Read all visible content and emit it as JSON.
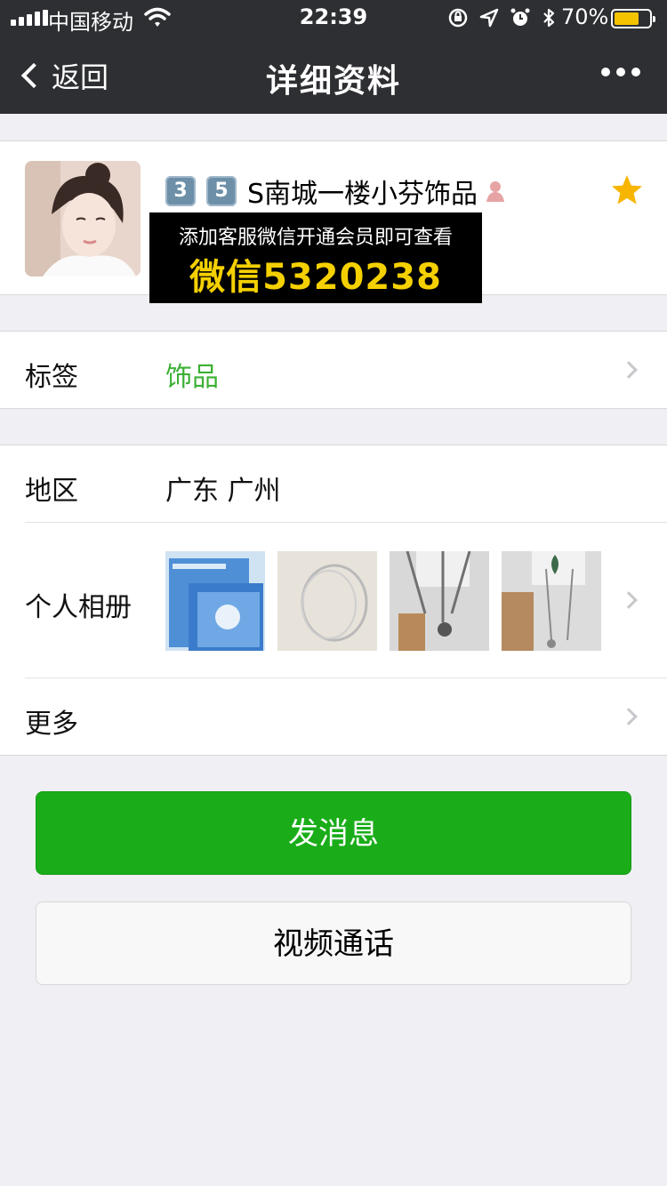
{
  "status_bar": {
    "carrier": "中国移动",
    "time": "22:39",
    "battery_percent": "70%",
    "battery_level": 0.7
  },
  "nav": {
    "back_label": "返回",
    "title": "详细资料"
  },
  "profile": {
    "badge_1": "3",
    "badge_2": "5",
    "name": "S南城一楼小芬饰品",
    "promo_line_1": "添加客服微信开通会员即可查看",
    "promo_line_2": "微信5320238"
  },
  "rows": {
    "tags": {
      "label": "标签",
      "value": "饰品"
    },
    "region": {
      "label": "地区",
      "value": "广东 广州"
    },
    "album": {
      "label": "个人相册"
    },
    "more": {
      "label": "更多"
    }
  },
  "buttons": {
    "message": "发消息",
    "video_call": "视频通话"
  },
  "colors": {
    "accent_green": "#1aad19",
    "tag_green": "#3cb035",
    "nav_bg": "#2e2f33",
    "promo_yellow": "#f5d000",
    "star": "#f7b500"
  }
}
